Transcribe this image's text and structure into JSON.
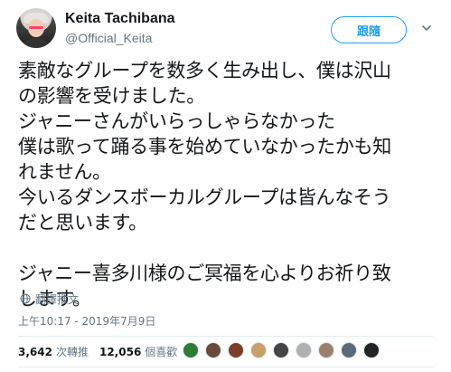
{
  "author": {
    "name": "Keita Tachibana",
    "handle": "@Official_Keita",
    "avatar_icon": "user-avatar-icon"
  },
  "header": {
    "follow_label": "跟隨",
    "menu_icon": "chevron-down-icon"
  },
  "tweet": {
    "lines": [
      "素敵なグループを数多く生み出し、僕は沢山",
      "の影響を受けました。",
      "ジャニーさんがいらっしゃらなかった",
      "僕は歌って踊る事を始めていなかったかも知",
      "れません。",
      "今いるダンスボーカルグループは皆んなそう",
      "だと思います。",
      "",
      "ジャニー喜多川様のご冥福を心よりお祈り致",
      "します。"
    ],
    "translate_label": "翻譯推文",
    "timestamp": "上午10:17 - 2019年7月9日"
  },
  "stats": {
    "retweets_count": "3,642",
    "retweets_label": "次轉推",
    "likes_count": "12,056",
    "likes_label": "個喜歡"
  },
  "colors": {
    "accent": "#1da1f2",
    "secondary_text": "#657786",
    "divider": "#e6ecf0"
  },
  "liker_avatars": [
    {
      "name": "liker-avatar-1",
      "color": "#2e7d32"
    },
    {
      "name": "liker-avatar-2",
      "color": "#6a4a3a"
    },
    {
      "name": "liker-avatar-3",
      "color": "#7b3f2a"
    },
    {
      "name": "liker-avatar-4",
      "color": "#c9a06a"
    },
    {
      "name": "liker-avatar-5",
      "color": "#444444"
    },
    {
      "name": "liker-avatar-6",
      "color": "#b0b0b0"
    },
    {
      "name": "liker-avatar-7",
      "color": "#9c7f6b"
    },
    {
      "name": "liker-avatar-8",
      "color": "#5a6a7a"
    },
    {
      "name": "liker-avatar-9",
      "color": "#222222"
    }
  ]
}
